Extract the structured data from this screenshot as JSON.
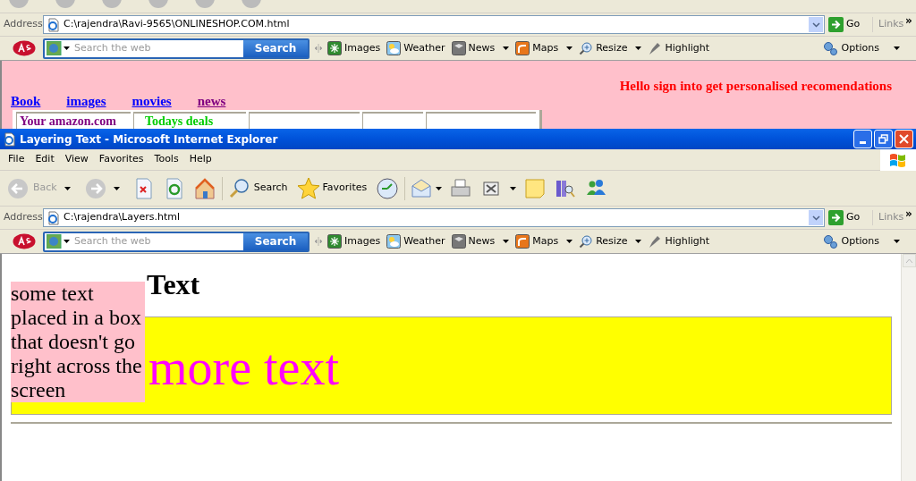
{
  "back_window": {
    "address": {
      "label": "Address",
      "value": "C:\\rajendra\\Ravi-9565\\ONLINESHOP.COM.html",
      "go": "Go",
      "links": "Links",
      "chevron": "»"
    },
    "ask_bar": {
      "placeholder": "Search the web",
      "search_button": "Search",
      "items": [
        {
          "label": "Images",
          "dropdown": false
        },
        {
          "label": "Weather",
          "dropdown": false
        },
        {
          "label": "News",
          "dropdown": true
        },
        {
          "label": "Maps",
          "dropdown": true
        },
        {
          "label": "Resize",
          "dropdown": true
        },
        {
          "label": "Highlight",
          "dropdown": false
        }
      ],
      "options": "Options"
    },
    "page": {
      "greeting": "Hello sign into get personalised recomendations",
      "nav_links": [
        {
          "label": "Book",
          "visited": false
        },
        {
          "label": "images",
          "visited": false
        },
        {
          "label": "movies",
          "visited": false
        },
        {
          "label": "news",
          "visited": true
        }
      ],
      "table_cells": [
        {
          "text": "Your amazon.com",
          "color": "#800080"
        },
        {
          "text": "Todays deals",
          "color": "#00cc00"
        }
      ]
    }
  },
  "front_window": {
    "title": "Layering Text - Microsoft Internet Explorer",
    "menu": [
      "File",
      "Edit",
      "View",
      "Favorites",
      "Tools",
      "Help"
    ],
    "toolbar": {
      "back": {
        "label": "Back",
        "disabled": true
      },
      "search": "Search",
      "favorites": "Favorites"
    },
    "address": {
      "label": "Address",
      "value": "C:\\rajendra\\Layers.html",
      "go": "Go",
      "links": "Links",
      "chevron": "»"
    },
    "ask_bar": {
      "placeholder": "Search the web",
      "search_button": "Search",
      "items": [
        {
          "label": "Images",
          "dropdown": false
        },
        {
          "label": "Weather",
          "dropdown": false
        },
        {
          "label": "News",
          "dropdown": true
        },
        {
          "label": "Maps",
          "dropdown": true
        },
        {
          "label": "Resize",
          "dropdown": true
        },
        {
          "label": "Highlight",
          "dropdown": false
        }
      ],
      "options": "Options"
    },
    "page": {
      "heading": "Text",
      "box_text": "some text placed in a box that doesn't go right across the screen",
      "banner_text": "more text"
    }
  }
}
